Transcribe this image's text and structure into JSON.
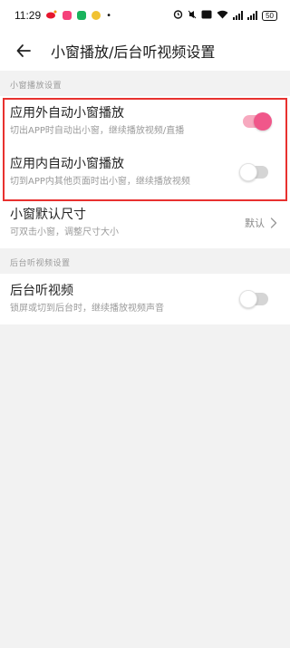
{
  "statusbar": {
    "time": "11:29",
    "network_speed": "B/s",
    "battery": "50"
  },
  "header": {
    "back_icon": "arrow-left-icon",
    "title": "小窗播放/后台听视频设置"
  },
  "section_pip": {
    "label": "小窗播放设置",
    "items": [
      {
        "title": "应用外自动小窗播放",
        "subtitle": "切出APP时自动出小窗，继续播放视频/直播",
        "toggle": "on"
      },
      {
        "title": "应用内自动小窗播放",
        "subtitle": "切到APP内其他页面时出小窗，继续播放视频",
        "toggle": "off"
      },
      {
        "title": "小窗默认尺寸",
        "subtitle": "可双击小窗，调整尺寸大小",
        "value": "默认"
      }
    ]
  },
  "section_background": {
    "label": "后台听视频设置",
    "items": [
      {
        "title": "后台听视频",
        "subtitle": "锁屏或切到后台时，继续播放视频声音",
        "toggle": "off"
      }
    ]
  },
  "colors": {
    "accent": "#f0578a",
    "highlight_border": "#e8312f",
    "background": "#f2f2f2"
  }
}
